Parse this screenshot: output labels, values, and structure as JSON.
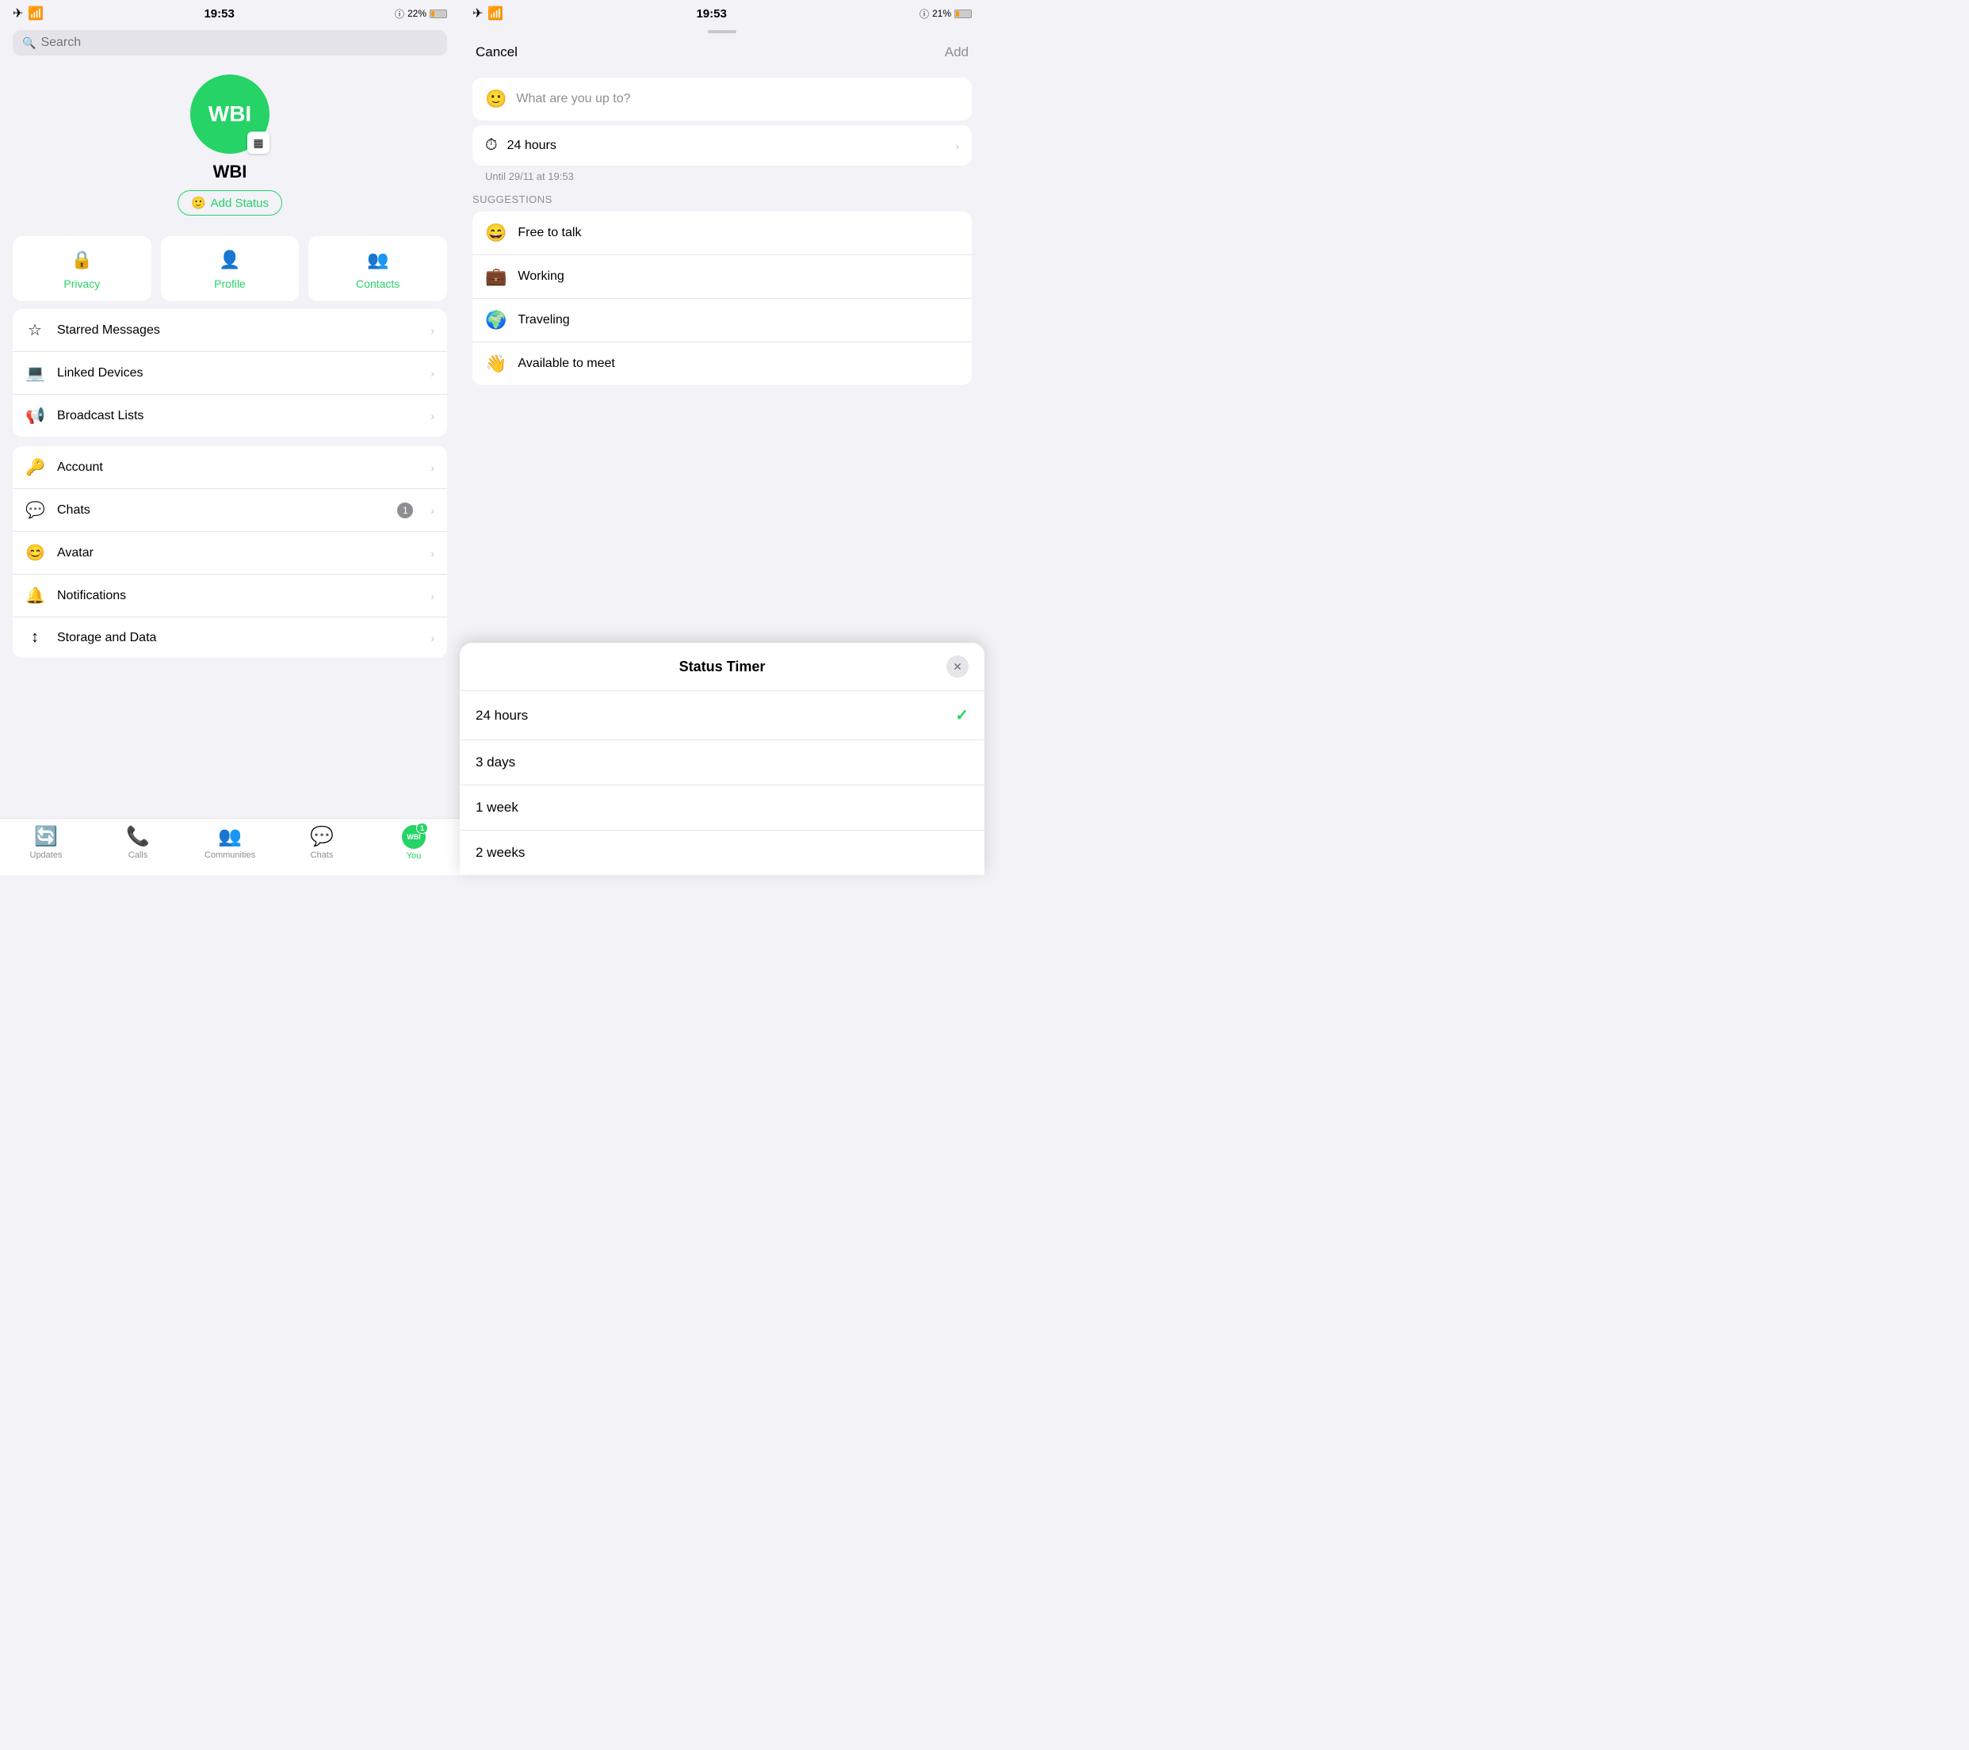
{
  "left": {
    "statusBar": {
      "time": "19:53",
      "battery": "22%"
    },
    "search": {
      "placeholder": "Search"
    },
    "profile": {
      "initials": "WBI",
      "name": "WBI",
      "addStatusLabel": "Add Status"
    },
    "quickActions": [
      {
        "id": "privacy",
        "icon": "🔒",
        "label": "Privacy"
      },
      {
        "id": "profile",
        "icon": "👤",
        "label": "Profile"
      },
      {
        "id": "contacts",
        "icon": "👥",
        "label": "Contacts"
      }
    ],
    "menuSection1": [
      {
        "id": "starred",
        "icon": "☆",
        "label": "Starred Messages"
      },
      {
        "id": "linked",
        "icon": "💻",
        "label": "Linked Devices"
      },
      {
        "id": "broadcast",
        "icon": "📢",
        "label": "Broadcast Lists"
      }
    ],
    "menuSection2": [
      {
        "id": "account",
        "icon": "🔑",
        "label": "Account",
        "badge": null
      },
      {
        "id": "chats",
        "icon": "💬",
        "label": "Chats",
        "badge": "1"
      },
      {
        "id": "avatar",
        "icon": "😊",
        "label": "Avatar",
        "badge": null
      },
      {
        "id": "notifications",
        "icon": "🔔",
        "label": "Notifications",
        "badge": null
      },
      {
        "id": "storage",
        "icon": "↕",
        "label": "Storage and Data",
        "badge": null
      }
    ],
    "tabs": [
      {
        "id": "updates",
        "icon": "🔄",
        "label": "Updates",
        "active": false
      },
      {
        "id": "calls",
        "icon": "📞",
        "label": "Calls",
        "active": false
      },
      {
        "id": "communities",
        "icon": "👥",
        "label": "Communities",
        "active": false
      },
      {
        "id": "chats",
        "icon": "💬",
        "label": "Chats",
        "active": false
      },
      {
        "id": "you",
        "icon": "WBI",
        "label": "You",
        "active": true,
        "badge": "1"
      }
    ]
  },
  "right": {
    "statusBar": {
      "time": "19:53",
      "battery": "21%"
    },
    "sheet": {
      "cancelLabel": "Cancel",
      "addLabel": "Add",
      "statusPlaceholder": "What are you up to?",
      "timerLabel": "24 hours",
      "untilText": "Until 29/11 at 19:53",
      "suggestionsTitle": "SUGGESTIONS",
      "suggestions": [
        {
          "emoji": "😄",
          "text": "Free to talk"
        },
        {
          "emoji": "💼",
          "text": "Working"
        },
        {
          "emoji": "🌍",
          "text": "Traveling"
        },
        {
          "emoji": "👋",
          "text": "Available to meet"
        }
      ]
    },
    "timerModal": {
      "title": "Status Timer",
      "options": [
        {
          "label": "24 hours",
          "selected": true
        },
        {
          "label": "3 days",
          "selected": false
        },
        {
          "label": "1 week",
          "selected": false
        },
        {
          "label": "2 weeks",
          "selected": false
        }
      ],
      "closeIcon": "✕"
    }
  }
}
